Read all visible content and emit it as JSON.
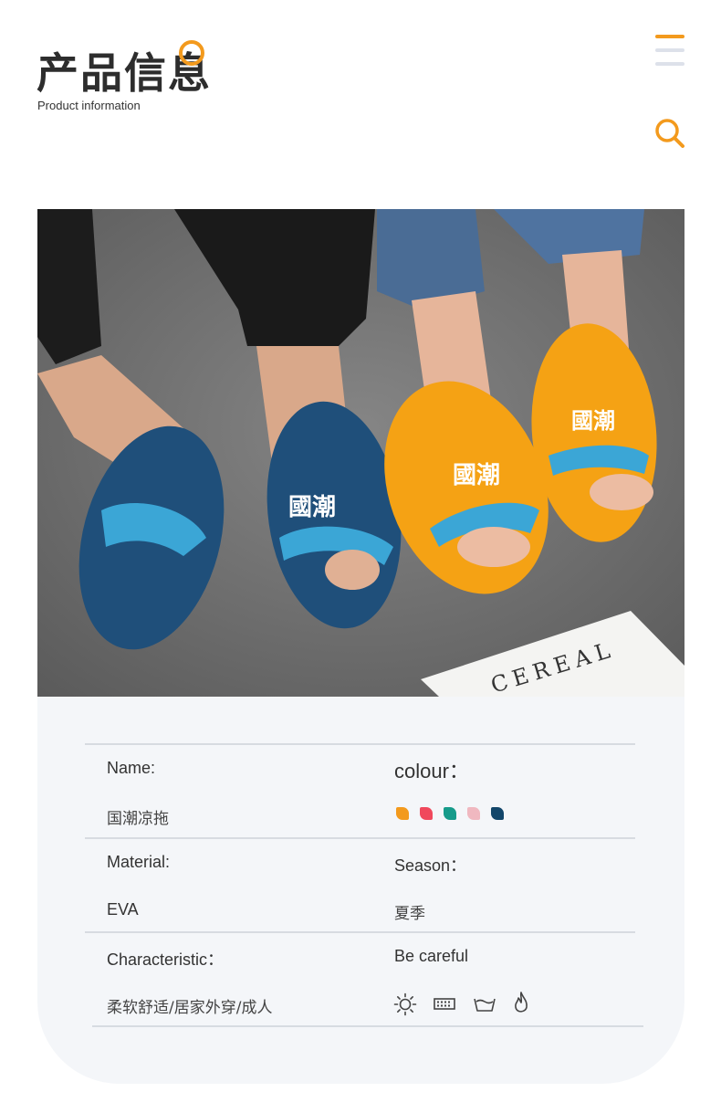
{
  "header": {
    "title_zh": "产品信息",
    "title_en": "Product information",
    "accent_color": "#f39a1d",
    "menu_icon": "hamburger-menu-icon",
    "search_icon": "search-icon"
  },
  "photo": {
    "description_icon": "product-photo",
    "slipper_colors": [
      "#1f4f7a",
      "#f5a214"
    ],
    "embossed_text": "國潮",
    "magazine_text": "CEREAL"
  },
  "info": {
    "name_label": "Name:",
    "name_value": "国潮凉拖",
    "colour_label": "colour：",
    "colours": [
      "#f39a1d",
      "#f0485c",
      "#169b8a",
      "#f0b8c0",
      "#12466a"
    ],
    "material_label": "Material:",
    "material_value": "EVA",
    "season_label": "Season：",
    "season_value": "夏季",
    "characteristic_label": "Characteristic：",
    "characteristic_value": "柔软舒适/居家外穿/成人",
    "careful_label": "Be careful",
    "care_icons": [
      "sun-icon",
      "iron-icon",
      "wash-basin-icon",
      "flame-icon"
    ]
  }
}
